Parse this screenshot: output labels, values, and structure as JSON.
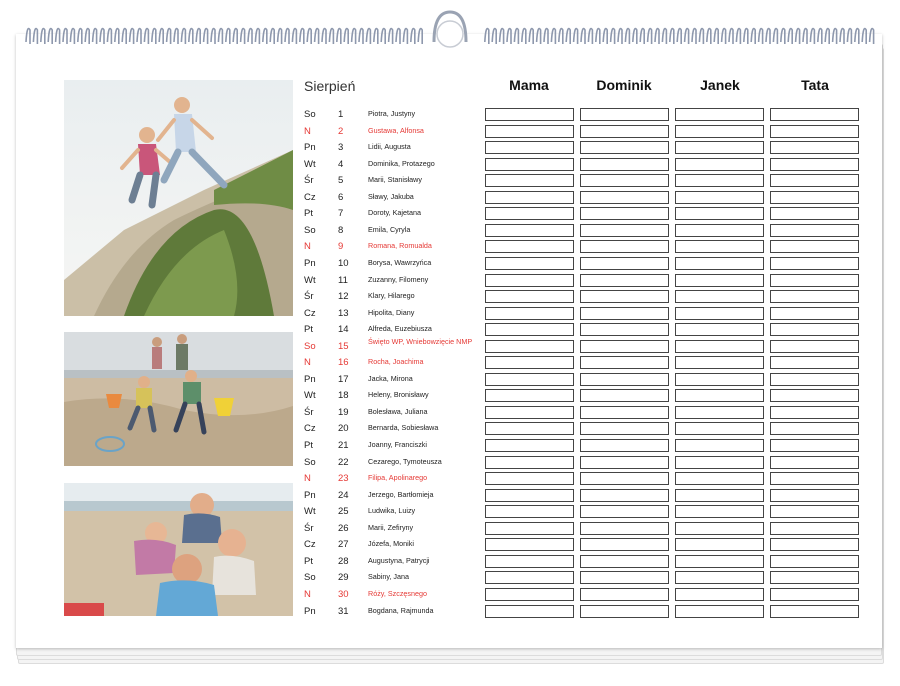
{
  "calendar": {
    "month": "Sierpień",
    "columns": [
      "Mama",
      "Dominik",
      "Janek",
      "Tata"
    ],
    "days": [
      {
        "dow": "So",
        "num": "1",
        "names": "Piotra, Justyny",
        "holiday": false
      },
      {
        "dow": "N",
        "num": "2",
        "names": "Gustawa, Alfonsa",
        "holiday": true
      },
      {
        "dow": "Pn",
        "num": "3",
        "names": "Lidii, Augusta",
        "holiday": false
      },
      {
        "dow": "Wt",
        "num": "4",
        "names": "Dominika, Protazego",
        "holiday": false
      },
      {
        "dow": "Śr",
        "num": "5",
        "names": "Marii, Stanisławy",
        "holiday": false
      },
      {
        "dow": "Cz",
        "num": "6",
        "names": "Sławy, Jakuba",
        "holiday": false
      },
      {
        "dow": "Pt",
        "num": "7",
        "names": "Doroty, Kajetana",
        "holiday": false
      },
      {
        "dow": "So",
        "num": "8",
        "names": "Emila, Cyryla",
        "holiday": false
      },
      {
        "dow": "N",
        "num": "9",
        "names": "Romana, Romualda",
        "holiday": true
      },
      {
        "dow": "Pn",
        "num": "10",
        "names": "Borysa, Wawrzyńca",
        "holiday": false
      },
      {
        "dow": "Wt",
        "num": "11",
        "names": "Zuzanny, Filomeny",
        "holiday": false
      },
      {
        "dow": "Śr",
        "num": "12",
        "names": "Klary, Hilarego",
        "holiday": false
      },
      {
        "dow": "Cz",
        "num": "13",
        "names": "Hipolita, Diany",
        "holiday": false
      },
      {
        "dow": "Pt",
        "num": "14",
        "names": "Alfreda, Euzebiusza",
        "holiday": false
      },
      {
        "dow": "So",
        "num": "15",
        "names": "Święto WP, Wniebowzięcie NMP",
        "holiday": true
      },
      {
        "dow": "N",
        "num": "16",
        "names": "Rocha, Joachima",
        "holiday": true
      },
      {
        "dow": "Pn",
        "num": "17",
        "names": "Jacka, Mirona",
        "holiday": false
      },
      {
        "dow": "Wt",
        "num": "18",
        "names": "Heleny, Bronisławy",
        "holiday": false
      },
      {
        "dow": "Śr",
        "num": "19",
        "names": "Bolesława, Juliana",
        "holiday": false
      },
      {
        "dow": "Cz",
        "num": "20",
        "names": "Bernarda, Sobiesława",
        "holiday": false
      },
      {
        "dow": "Pt",
        "num": "21",
        "names": "Joanny, Franciszki",
        "holiday": false
      },
      {
        "dow": "So",
        "num": "22",
        "names": "Cezarego, Tymoteusza",
        "holiday": false
      },
      {
        "dow": "N",
        "num": "23",
        "names": "Filipa, Apolinarego",
        "holiday": true
      },
      {
        "dow": "Pn",
        "num": "24",
        "names": "Jerzego, Bartłomieja",
        "holiday": false
      },
      {
        "dow": "Wt",
        "num": "25",
        "names": "Ludwika, Luizy",
        "holiday": false
      },
      {
        "dow": "Śr",
        "num": "26",
        "names": "Marii, Zefiryny",
        "holiday": false
      },
      {
        "dow": "Cz",
        "num": "27",
        "names": "Józefa, Moniki",
        "holiday": false
      },
      {
        "dow": "Pt",
        "num": "28",
        "names": "Augustyna, Patrycji",
        "holiday": false
      },
      {
        "dow": "So",
        "num": "29",
        "names": "Sabiny, Jana",
        "holiday": false
      },
      {
        "dow": "N",
        "num": "30",
        "names": "Róży, Szczęsnego",
        "holiday": true
      },
      {
        "dow": "Pn",
        "num": "31",
        "names": "Bogdana, Rajmunda",
        "holiday": false
      }
    ]
  },
  "photos": [
    {
      "subject": "children-jumping-dune-photo"
    },
    {
      "subject": "family-beach-buckets-photo"
    },
    {
      "subject": "family-beach-portrait-photo"
    }
  ],
  "colors": {
    "holiday": "#e53935",
    "text": "#222222",
    "cell_border": "#444444"
  }
}
